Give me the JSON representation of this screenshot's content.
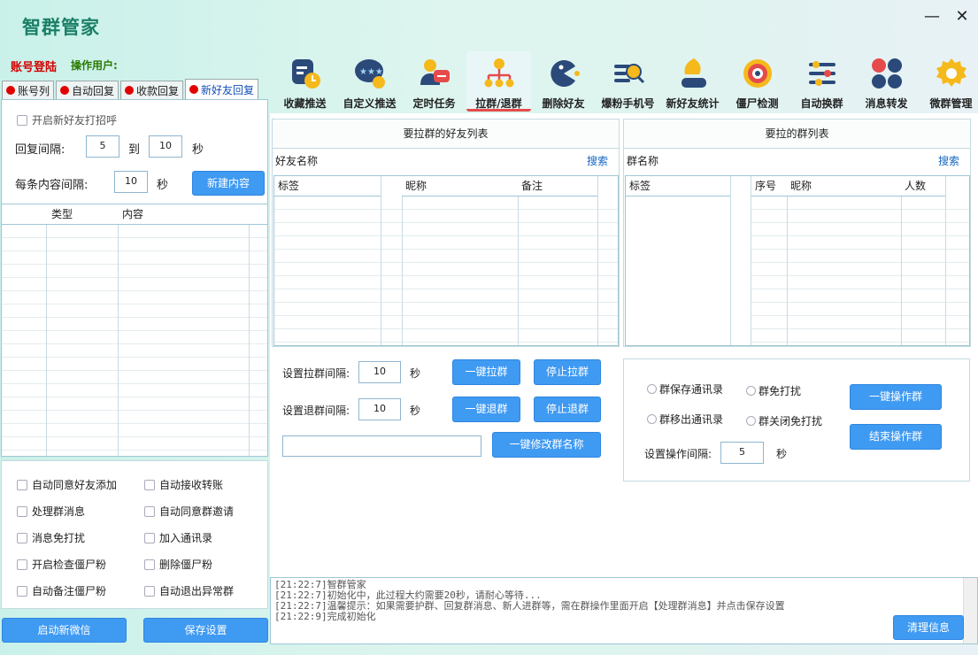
{
  "app": {
    "title": "智群管家",
    "login": "账号登陆",
    "operator": "操作用户:"
  },
  "window": {
    "minimize": "—",
    "close": "✕"
  },
  "tabs": [
    {
      "label": "账号列"
    },
    {
      "label": "自动回复"
    },
    {
      "label": "收款回复"
    },
    {
      "label": "新好友回复"
    }
  ],
  "toolbar": [
    {
      "label": "收藏推送",
      "icon": "favorites-push-icon"
    },
    {
      "label": "自定义推送",
      "icon": "custom-push-icon"
    },
    {
      "label": "定时任务",
      "icon": "scheduled-task-icon"
    },
    {
      "label": "拉群/退群",
      "icon": "pull-quit-group-icon"
    },
    {
      "label": "删除好友",
      "icon": "delete-friend-icon"
    },
    {
      "label": "爆粉手机号",
      "icon": "phone-number-icon"
    },
    {
      "label": "新好友统计",
      "icon": "friend-stats-icon"
    },
    {
      "label": "僵尸检测",
      "icon": "zombie-detect-icon"
    },
    {
      "label": "自动换群",
      "icon": "auto-switch-group-icon"
    },
    {
      "label": "消息转发",
      "icon": "message-forward-icon"
    },
    {
      "label": "微群管理",
      "icon": "group-manage-icon"
    }
  ],
  "newfriend": {
    "enable_label": "开启新好友打招呼",
    "interval_label": "回复间隔:",
    "from": "5",
    "to_label": "到",
    "to": "10",
    "sec": "秒",
    "each_label": "每条内容间隔:",
    "each": "10",
    "each_sec": "秒",
    "new_btn": "新建内容",
    "col_type": "类型",
    "col_content": "内容"
  },
  "options": [
    {
      "label": "自动同意好友添加"
    },
    {
      "label": "自动接收转账"
    },
    {
      "label": "处理群消息"
    },
    {
      "label": "自动同意群邀请"
    },
    {
      "label": "消息免打扰"
    },
    {
      "label": "加入通讯录"
    },
    {
      "label": "开启检查僵尸粉"
    },
    {
      "label": "删除僵尸粉"
    },
    {
      "label": "自动备注僵尸粉"
    },
    {
      "label": "自动退出异常群"
    }
  ],
  "bottom": {
    "start_btn": "启动新微信",
    "save_btn": "保存设置"
  },
  "friends": {
    "title": "要拉群的好友列表",
    "name_label": "好友名称",
    "search": "搜索",
    "col_tag": "标签",
    "col_nick": "昵称",
    "col_note": "备注"
  },
  "groups": {
    "title": "要拉的群列表",
    "name_label": "群名称",
    "search": "搜索",
    "col_tag": "标签",
    "col_no": "序号",
    "col_nick": "昵称",
    "col_count": "人数"
  },
  "pull": {
    "pull_label": "设置拉群间隔:",
    "pull_val": "10",
    "pull_sec": "秒",
    "pull_btn": "一键拉群",
    "stop_pull_btn": "停止拉群",
    "quit_label": "设置退群间隔:",
    "quit_val": "10",
    "quit_sec": "秒",
    "quit_btn": "一键退群",
    "stop_quit_btn": "停止退群",
    "rename_btn": "一键修改群名称"
  },
  "groupop": {
    "r1": "群保存通讯录",
    "r2": "群免打扰",
    "r3": "群移出通讯录",
    "r4": "群关闭免打扰",
    "op_btn": "一键操作群",
    "end_btn": "结束操作群",
    "interval_label": "设置操作间隔:",
    "interval_val": "5",
    "interval_sec": "秒"
  },
  "log": {
    "lines": [
      "[21:22:7]智群管家",
      "[21:22:7]初始化中，此过程大约需要20秒，请耐心等待...",
      "[21:22:7]温馨提示：如果需要护群、回复群消息、新人进群等，需在群操作里面开启【处理群消息】并点击保存设置",
      "[21:22:9]完成初始化"
    ],
    "clear_btn": "清理信息"
  }
}
